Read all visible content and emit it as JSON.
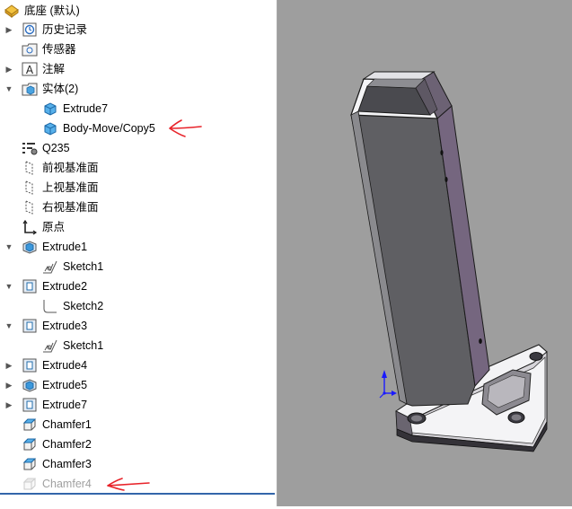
{
  "tree": {
    "root": {
      "label": "底座  (默认)",
      "icon": "part-icon"
    },
    "items": [
      {
        "label": "历史记录",
        "icon": "history-icon",
        "arrow": "right"
      },
      {
        "label": "传感器",
        "icon": "sensor-icon",
        "arrow": "none"
      },
      {
        "label": "注解",
        "icon": "annotation-icon",
        "arrow": "right"
      },
      {
        "label": "实体(2)",
        "icon": "solid-bodies-folder-icon",
        "arrow": "down"
      },
      {
        "label": "Extrude7",
        "icon": "solid-body-icon",
        "arrow": "none"
      },
      {
        "label": "Body-Move/Copy5",
        "icon": "solid-body-icon",
        "arrow": "none"
      },
      {
        "label": "Q235",
        "icon": "material-icon",
        "arrow": "none"
      },
      {
        "label": "前视基准面",
        "icon": "plane-icon",
        "arrow": "none"
      },
      {
        "label": "上视基准面",
        "icon": "plane-icon",
        "arrow": "none"
      },
      {
        "label": "右视基准面",
        "icon": "plane-icon",
        "arrow": "none"
      },
      {
        "label": "原点",
        "icon": "origin-icon",
        "arrow": "none"
      },
      {
        "label": "Extrude1",
        "icon": "extrude-icon",
        "arrow": "down"
      },
      {
        "label": "Sketch1",
        "icon": "sketch-icon",
        "arrow": "none"
      },
      {
        "label": "Extrude2",
        "icon": "extrude-cut-icon",
        "arrow": "down"
      },
      {
        "label": "Sketch2",
        "icon": "sketch-icon",
        "arrow": "none"
      },
      {
        "label": "Extrude3",
        "icon": "extrude-cut-icon",
        "arrow": "down"
      },
      {
        "label": "Sketch1",
        "icon": "sketch-icon",
        "arrow": "none"
      },
      {
        "label": "Extrude4",
        "icon": "extrude-cut-icon",
        "arrow": "right"
      },
      {
        "label": "Extrude5",
        "icon": "extrude-icon",
        "arrow": "right"
      },
      {
        "label": "Extrude7",
        "icon": "extrude-cut-icon",
        "arrow": "right"
      },
      {
        "label": "Chamfer1",
        "icon": "chamfer-icon",
        "arrow": "none"
      },
      {
        "label": "Chamfer2",
        "icon": "chamfer-icon",
        "arrow": "none"
      },
      {
        "label": "Chamfer3",
        "icon": "chamfer-icon",
        "arrow": "none"
      },
      {
        "label": "Chamfer4",
        "icon": "chamfer-icon",
        "arrow": "none",
        "suppressed": true
      }
    ]
  },
  "colors": {
    "viewport_bg": "#9e9e9e",
    "model_face": "#5f5f63",
    "model_side": "#75667f",
    "annotation_red": "#e8232a",
    "axis_blue": "#1a1aff"
  }
}
